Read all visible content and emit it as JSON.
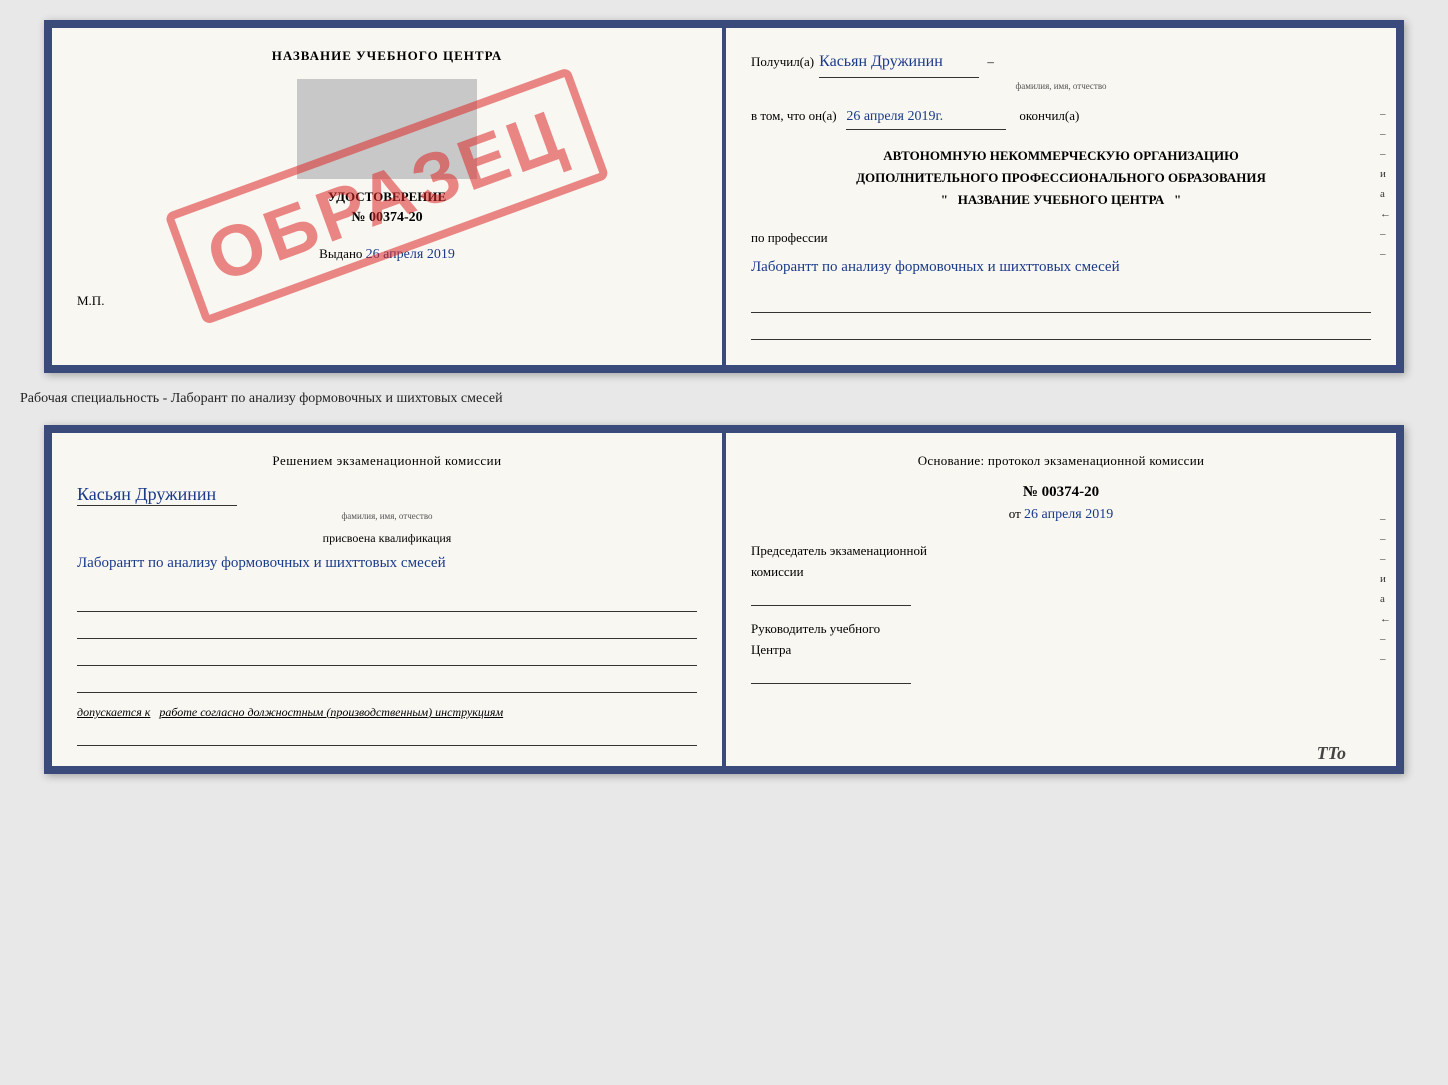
{
  "cert_top": {
    "left": {
      "title": "НАЗВАНИЕ УЧЕБНОГО ЦЕНТРА",
      "udostoverenie": "УДОСТОВЕРЕНИЕ",
      "number": "№ 00374-20",
      "vydano_label": "Выдано",
      "vydano_date": "26 апреля 2019",
      "mp": "М.П.",
      "stamp": "ОБРАЗЕЦ"
    },
    "right": {
      "poluchil_label": "Получил(а)",
      "poluchil_name": "Касьян Дружинин",
      "poluchil_sub": "фамилия, имя, отчество",
      "vtom_label": "в том, что он(а)",
      "vtom_date": "26 апреля 2019г.",
      "okonchil": "окончил(а)",
      "org_line1": "АВТОНОМНУЮ НЕКОММЕРЧЕСКУЮ ОРГАНИЗАЦИЮ",
      "org_line2": "ДОПОЛНИТЕЛЬНОГО ПРОФЕССИОНАЛЬНОГО ОБРАЗОВАНИЯ",
      "org_quote1": "\"",
      "org_name": "НАЗВАНИЕ УЧЕБНОГО ЦЕНТРА",
      "org_quote2": "\"",
      "profession_label": "по профессии",
      "profession_text": "Лаборантт по анализу формовочных и шихттовых смесей",
      "right_marks": [
        "–",
        "–",
        "–",
        "и",
        "а",
        "←",
        "–",
        "–"
      ]
    }
  },
  "separator": {
    "text": "Рабочая специальность - Лаборант по анализу формовочных и шихтовых смесей"
  },
  "cert_bottom": {
    "left": {
      "resheniem": "Решением экзаменационной комиссии",
      "name": "Касьян Дружинин",
      "name_sub": "фамилия, имя, отчество",
      "prisvoena": "присвоена квалификация",
      "kvali": "Лаборантт по анализу формовочных и шихттовых смесей",
      "dopuskaetsya": "допускается к",
      "dopusk_text": "работе согласно должностным (производственным) инструкциям"
    },
    "right": {
      "osnovanie": "Основание: протокол экзаменационной комиссии",
      "number": "№ 00374-20",
      "ot_label": "от",
      "ot_date": "26 апреля 2019",
      "predsedatel_line1": "Председатель экзаменационной",
      "predsedatel_line2": "комиссии",
      "rukovoditel_line1": "Руководитель учебного",
      "rukovoditel_line2": "Центра",
      "right_marks": [
        "–",
        "–",
        "–",
        "и",
        "а",
        "←",
        "–",
        "–"
      ]
    }
  },
  "tto": "TTo"
}
